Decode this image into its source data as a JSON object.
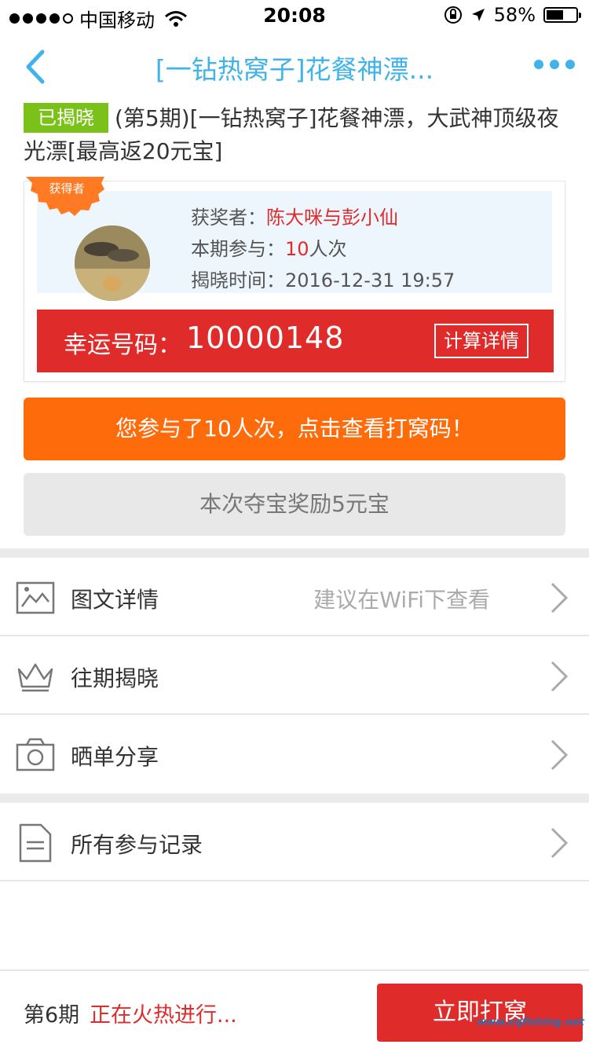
{
  "status_bar": {
    "carrier": "中国移动",
    "time": "20:08",
    "battery": "58%",
    "battery_level": 0.58
  },
  "nav": {
    "title": "[一钻热窝子]花餐神漂..."
  },
  "product": {
    "badge": "已揭晓",
    "title": "(第5期)[一钻热窝子]花餐神漂，大武神顶级夜光漂[最高返20元宝]"
  },
  "winner": {
    "ribbon": "获得者",
    "winner_label": "获奖者：",
    "winner_name": "陈大咪与彭小仙",
    "participation_label": "本期参与：",
    "participation_count": "10",
    "participation_unit": "人次",
    "reveal_label": "揭晓时间：",
    "reveal_time": "2016-12-31 19:57",
    "lucky_label": "幸运号码：",
    "lucky_number": "10000148",
    "calc_label": "计算详情"
  },
  "actions": {
    "view_codes": "您参与了10人次，点击查看打窝码！",
    "reward": "本次夺宝奖励5元宝"
  },
  "menu": [
    {
      "label": "图文详情",
      "hint": "建议在WiFi下查看",
      "icon": "image-icon"
    },
    {
      "label": "往期揭晓",
      "icon": "crown-icon"
    },
    {
      "label": "晒单分享",
      "icon": "camera-icon"
    },
    {
      "label": "所有参与记录",
      "icon": "document-icon"
    }
  ],
  "bottom": {
    "period": "第6期",
    "status": "正在火热进行...",
    "join_label": "立即打窝"
  },
  "watermark": "www.cqfishing.net",
  "colors": {
    "accent_blue": "#3fb3ea",
    "red": "#e02b2b",
    "orange": "#fd6b0b",
    "green": "#7ac11a"
  }
}
